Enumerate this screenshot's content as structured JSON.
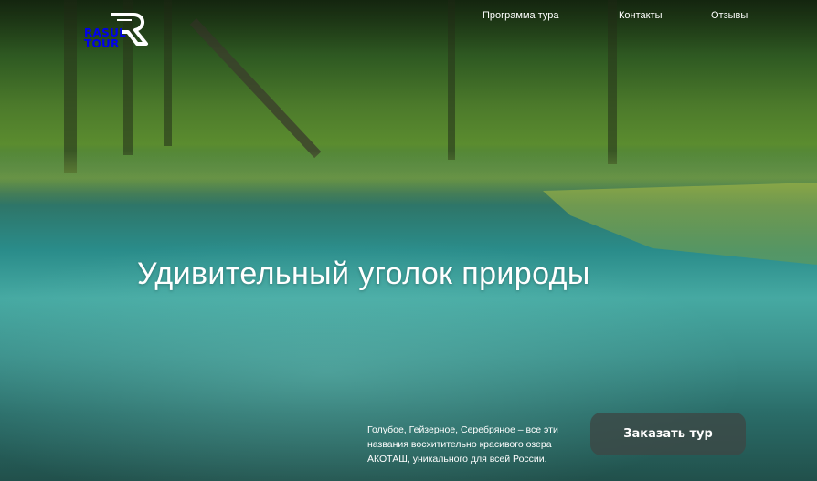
{
  "brand": {
    "logo_line1": "RASUL",
    "logo_line2": "TOUR"
  },
  "nav": {
    "items": [
      {
        "label": "Программа тура"
      },
      {
        "label": "Контакты"
      },
      {
        "label": "Отзывы"
      }
    ]
  },
  "hero": {
    "headline": "Удивительный уголок природы",
    "description": "Голубое, Гейзерное, Серебряное – все эти названия восхитительно красивого озера АКОТАШ, уникального для всей России.",
    "cta_label": "Заказать тур"
  },
  "colors": {
    "cta_background": "#3c4846",
    "text": "#ffffff"
  },
  "icons": {
    "logo_mark": "stylized-r-logo"
  }
}
